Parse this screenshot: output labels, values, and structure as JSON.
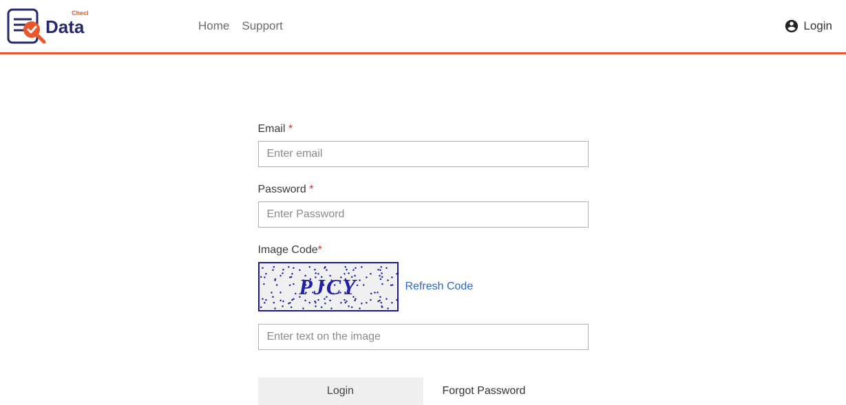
{
  "header": {
    "logo_text_main": "Data",
    "logo_text_sup": "Check",
    "nav": [
      {
        "label": "Home"
      },
      {
        "label": "Support"
      }
    ],
    "login_label": "Login"
  },
  "form": {
    "email": {
      "label": "Email ",
      "placeholder": "Enter email",
      "value": ""
    },
    "password": {
      "label": "Password ",
      "placeholder": "Enter Password",
      "value": ""
    },
    "captcha": {
      "label": "Image Code",
      "code": "PJCY",
      "refresh_label": "Refresh Code",
      "input_placeholder": "Enter text on the image",
      "value": ""
    },
    "submit_label": "Login",
    "forgot_label": "Forgot Password"
  },
  "colors": {
    "accent": "#e8582c",
    "link": "#2866c7",
    "captcha_border": "#1a1a8a"
  }
}
